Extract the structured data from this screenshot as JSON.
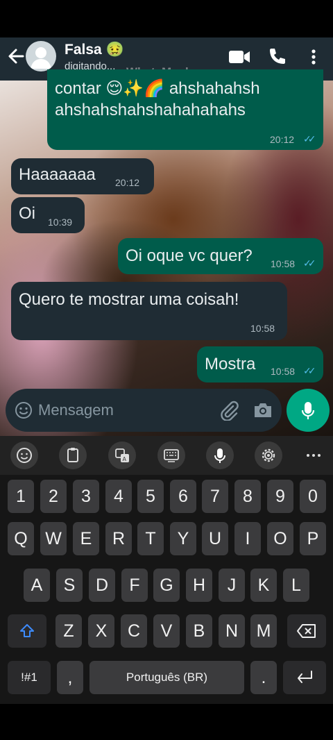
{
  "header": {
    "name": "Falsa 🤢",
    "status": "digitando...",
    "watermark": "WhatsMock"
  },
  "messages": [
    {
      "dir": "out",
      "text1": "contar 😌✨🌈  ahshahahsh",
      "text2": "ahshahshahshahahahahs",
      "time": "20:12"
    },
    {
      "dir": "in",
      "text": "Haaaaaaa",
      "time": "20:12"
    },
    {
      "dir": "in",
      "text": "Oi",
      "time": "10:39"
    },
    {
      "dir": "out",
      "text": "Oi oque vc quer?",
      "time": "10:58"
    },
    {
      "dir": "in",
      "text": "Quero te mostrar uma coisah!",
      "time": "10:58"
    },
    {
      "dir": "out",
      "text": "Mostra",
      "time": "10:58"
    }
  ],
  "input": {
    "placeholder": "Mensagem"
  },
  "keyboard": {
    "numbers": [
      "1",
      "2",
      "3",
      "4",
      "5",
      "6",
      "7",
      "8",
      "9",
      "0"
    ],
    "row1": [
      "Q",
      "W",
      "E",
      "R",
      "T",
      "Y",
      "U",
      "I",
      "O",
      "P"
    ],
    "row2": [
      "A",
      "S",
      "D",
      "F",
      "G",
      "H",
      "J",
      "K",
      "L"
    ],
    "row3": [
      "Z",
      "X",
      "C",
      "V",
      "B",
      "N",
      "M"
    ],
    "symbols": "!#1",
    "comma": ",",
    "space": "Português (BR)",
    "period": "."
  },
  "colors": {
    "header": "#1f2c34",
    "incoming": "#1f2c34",
    "outgoing": "#005c4b",
    "accent": "#00a884",
    "read_ticks": "#53bdeb"
  }
}
